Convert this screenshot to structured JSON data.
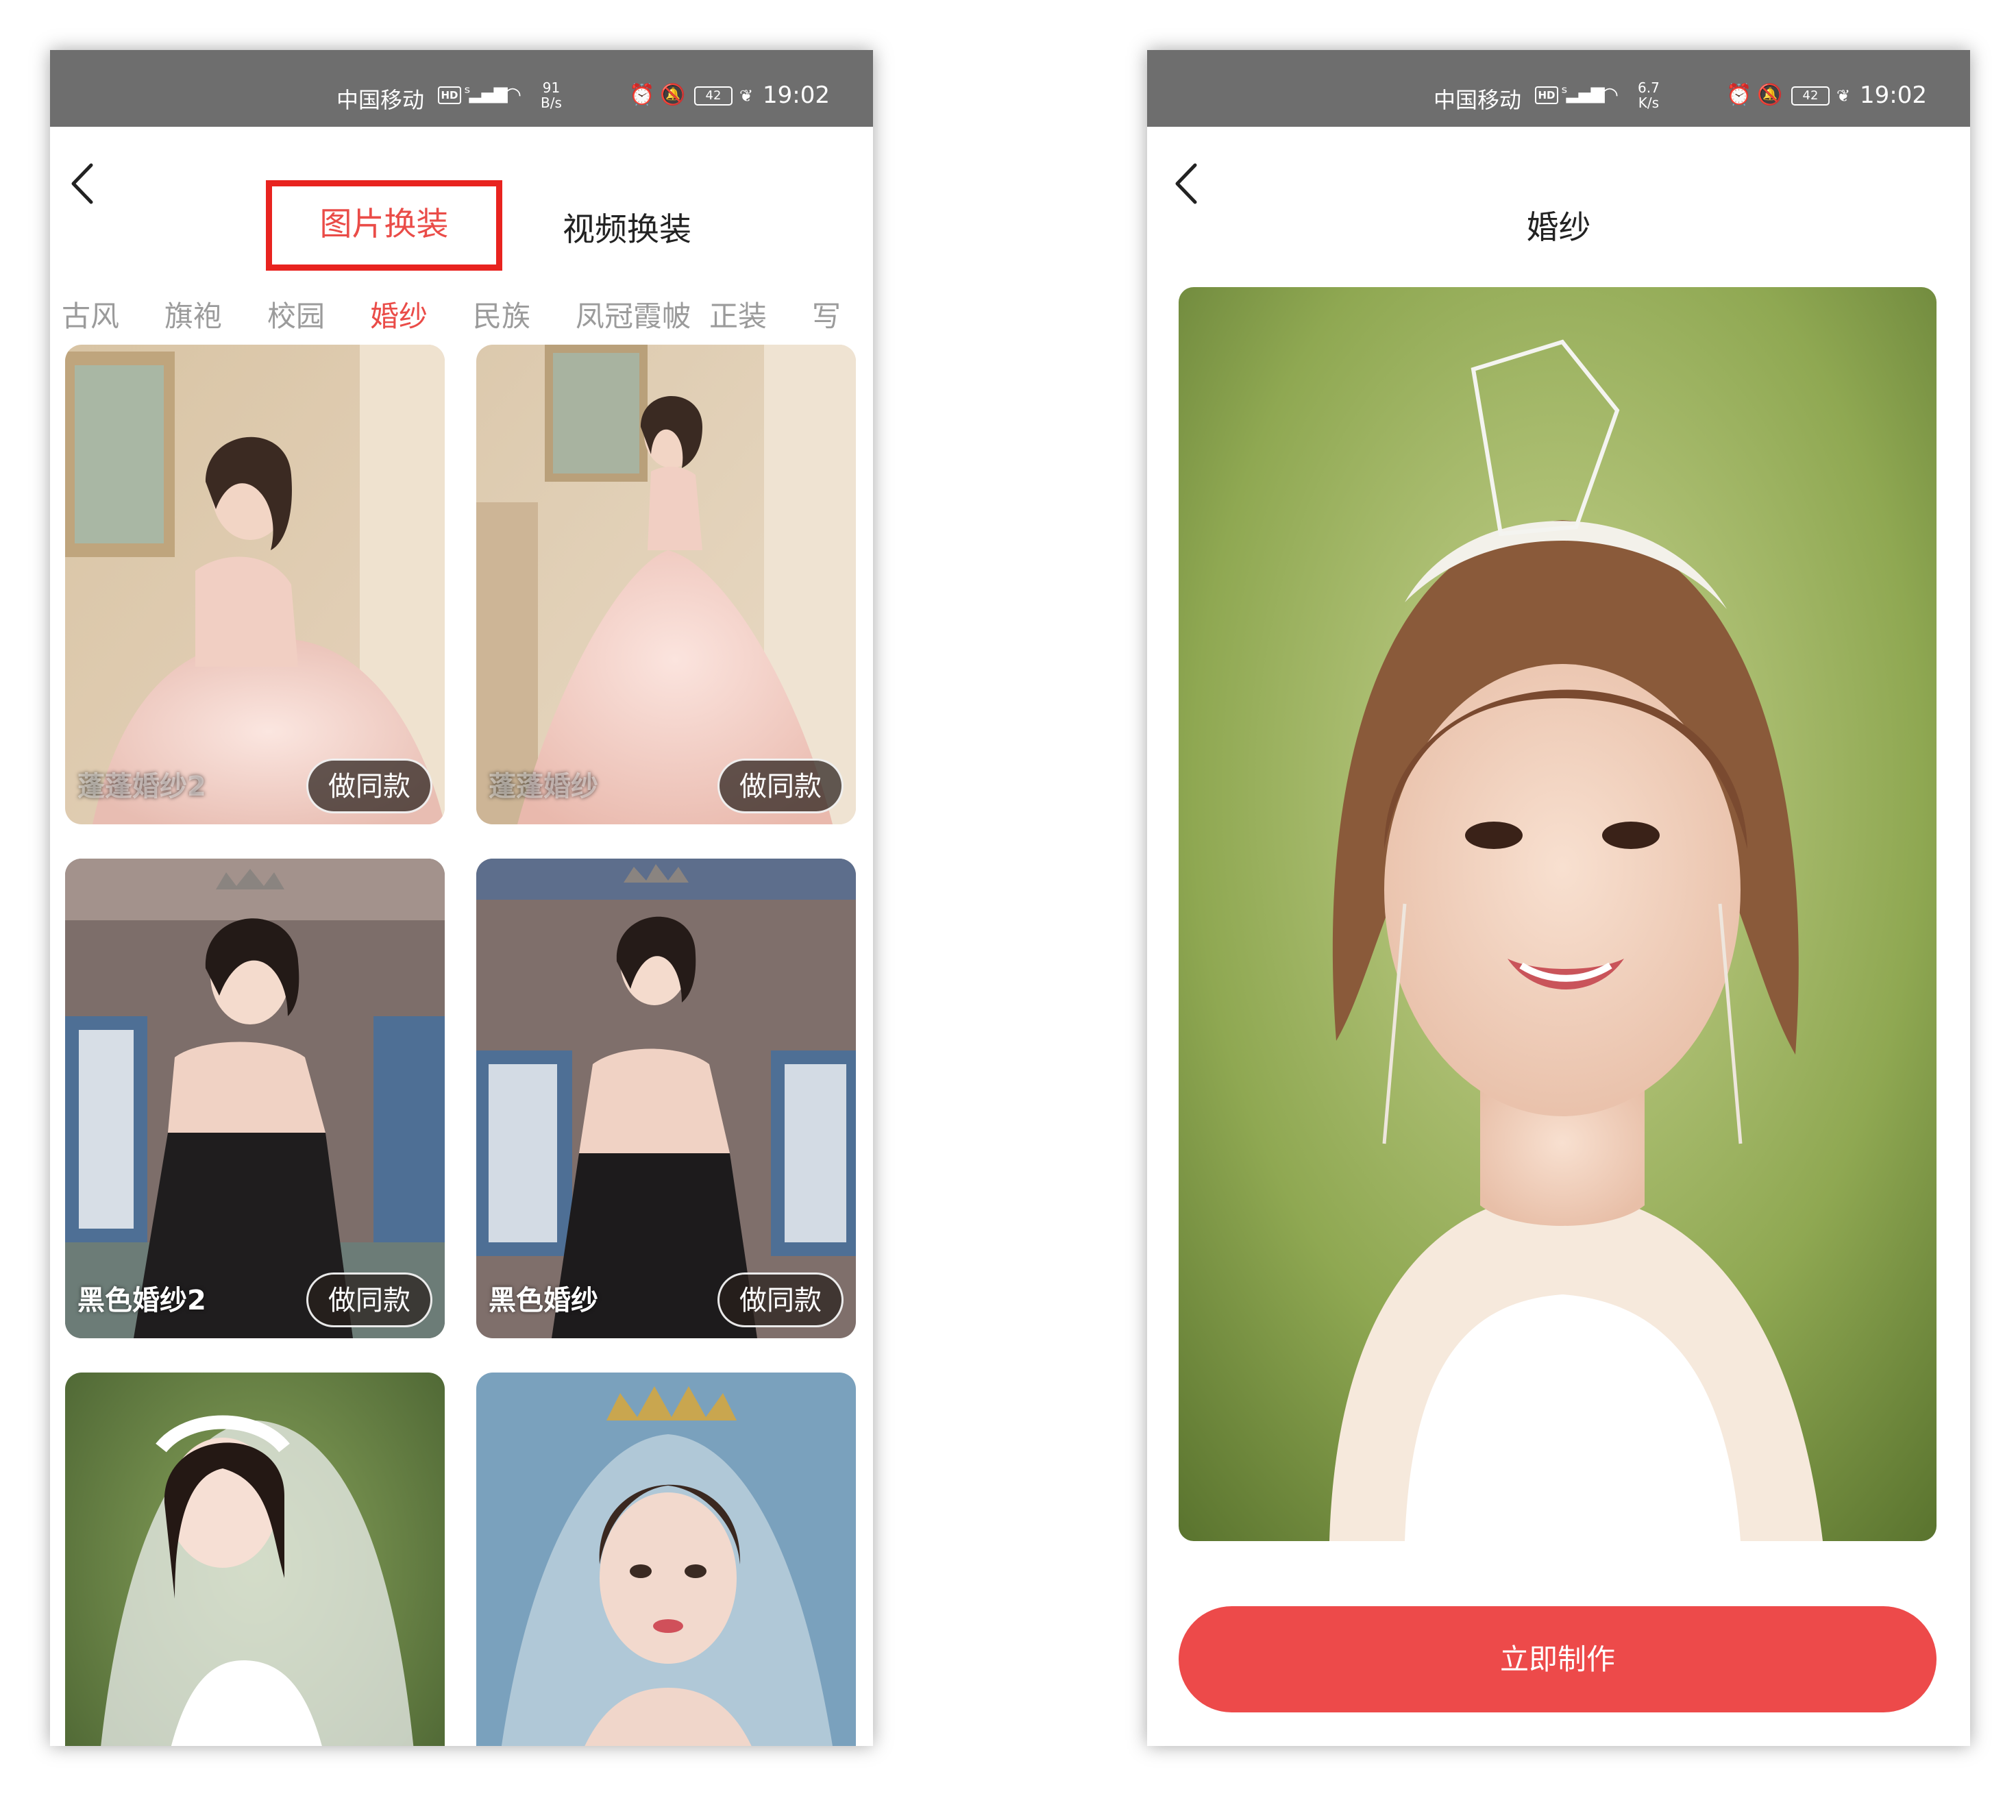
{
  "status_bar": {
    "carrier": "中国移动",
    "hd": "HD",
    "network": "4G",
    "battery": "42",
    "time": "19:02",
    "left_speed_value": "91",
    "left_speed_unit": "B/s",
    "right_speed_value": "6.7",
    "right_speed_unit": "K/s"
  },
  "left_screen": {
    "tabs": [
      {
        "label": "图片换装",
        "selected": true
      },
      {
        "label": "视频换装",
        "selected": false
      }
    ],
    "categories": [
      "古风",
      "旗袍",
      "校园",
      "婚纱",
      "民族",
      "凤冠霞帔",
      "正装",
      "写"
    ],
    "active_category": "婚纱",
    "cards": [
      {
        "title": "蓬蓬婚纱2",
        "button": "做同款"
      },
      {
        "title": "蓬蓬婚纱",
        "button": "做同款"
      },
      {
        "title": "黑色婚纱2",
        "button": "做同款"
      },
      {
        "title": "黑色婚纱",
        "button": "做同款"
      },
      {
        "title": "",
        "button": ""
      },
      {
        "title": "",
        "button": ""
      }
    ]
  },
  "right_screen": {
    "title": "婚纱",
    "action_button": "立即制作"
  },
  "colors": {
    "accent": "#ea4c48",
    "highlight_box": "#e8231f",
    "status_bar": "#6e6e6e",
    "action_button": "#ed4a4a"
  }
}
